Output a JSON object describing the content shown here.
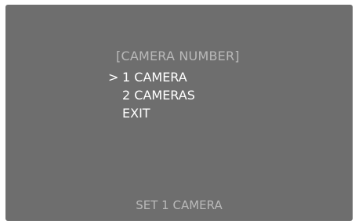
{
  "menu": {
    "title": "[CAMERA NUMBER]",
    "cursor_glyph": ">",
    "selected_index": 0,
    "items": [
      {
        "label": "1 CAMERA"
      },
      {
        "label": "2 CAMERAS"
      },
      {
        "label": "EXIT"
      }
    ]
  },
  "status": {
    "text": "SET 1 CAMERA"
  },
  "colors": {
    "screen_background": "#6e6e6e",
    "highlight_text": "#ffffff",
    "dim_text": "#b9b9b9"
  }
}
